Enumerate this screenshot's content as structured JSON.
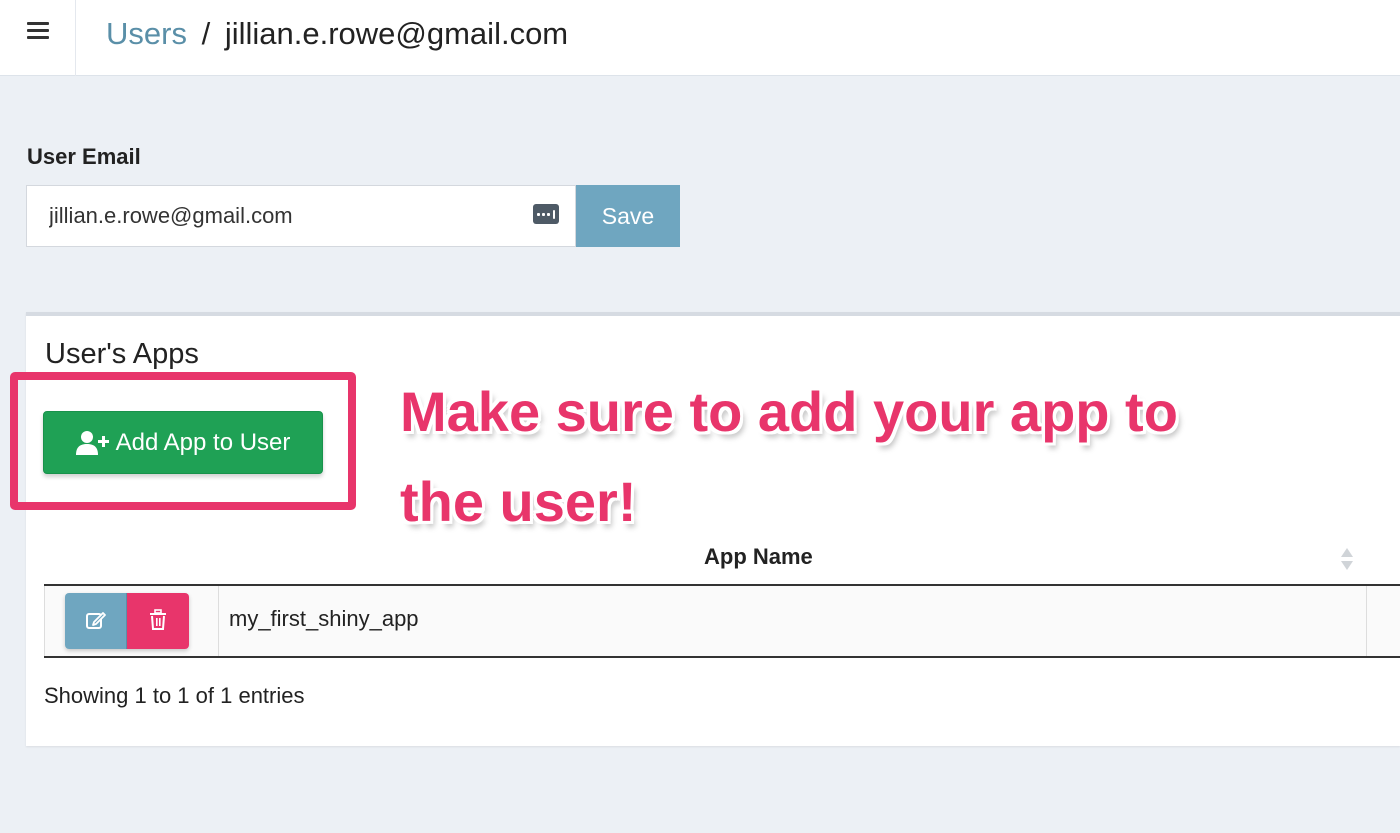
{
  "header": {
    "menu_icon": "hamburger-icon",
    "breadcrumb": {
      "link": "Users",
      "separator": "/",
      "current": "jillian.e.rowe@gmail.com"
    }
  },
  "form": {
    "label": "User Email",
    "email_value": "jillian.e.rowe@gmail.com",
    "password_manager_icon": "password-dots-icon",
    "save_label": "Save"
  },
  "apps_panel": {
    "title": "User's Apps",
    "add_button_label": "Add App to User",
    "add_button_icon": "user-plus-icon",
    "annotation_line1": "Make sure to add your app to",
    "annotation_line2": "the user!",
    "table": {
      "columns": [
        "",
        "App Name"
      ],
      "rows": [
        {
          "app_name": "my_first_shiny_app"
        }
      ]
    },
    "entries_info": "Showing 1 to 1 of 1 entries"
  },
  "colors": {
    "link": "#5a8fa8",
    "save_button": "#6fa6c0",
    "add_button": "#1fa155",
    "annotation": "#e8356b",
    "delete_button": "#e8356b",
    "background": "#ecf0f5"
  }
}
